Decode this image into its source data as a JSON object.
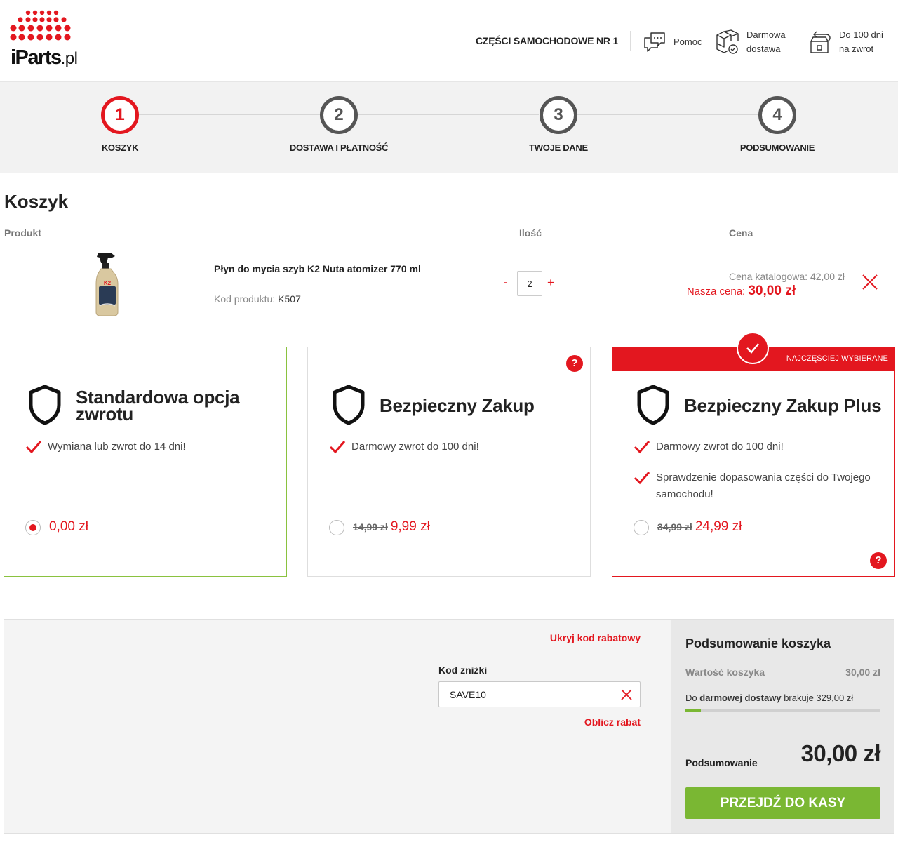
{
  "header": {
    "logo_text": "iParts",
    "logo_tld": ".pl",
    "tagline": "CZĘŚCI SAMOCHODOWE NR 1",
    "help": {
      "icon": "chat-bubbles-icon",
      "label": "Pomoc"
    },
    "delivery": {
      "icon": "boxes-icon",
      "line1": "Darmowa",
      "line2": "dostawa"
    },
    "returns": {
      "icon": "return-box-icon",
      "line1": "Do 100 dni",
      "line2": "na zwrot"
    }
  },
  "steps": [
    {
      "number": "1",
      "label": "KOSZYK",
      "active": true
    },
    {
      "number": "2",
      "label": "DOSTAWA I PŁATNOŚĆ",
      "active": false
    },
    {
      "number": "3",
      "label": "TWOJE DANE",
      "active": false
    },
    {
      "number": "4",
      "label": "PODSUMOWANIE",
      "active": false
    }
  ],
  "cart": {
    "title": "Koszyk",
    "columns": {
      "product": "Produkt",
      "qty": "Ilość",
      "price": "Cena"
    },
    "item": {
      "name": "Płyn do mycia szyb K2 Nuta atomizer 770 ml",
      "code_label": "Kod produktu:",
      "code": "K507",
      "qty": "2",
      "qty_minus": "-",
      "qty_plus": "+",
      "catalog_price": "Cena katalogowa: 42,00 zł",
      "our_price_label": "Nasza cena:",
      "our_price": "30,00 zł"
    }
  },
  "options": [
    {
      "title": "Standardowa opcja zwrotu",
      "features": [
        "Wymiana lub zwrot do 14 dni!"
      ],
      "old_price": "",
      "price": "0,00 zł",
      "selected": true
    },
    {
      "title": "Bezpieczny Zakup",
      "features": [
        "Darmowy zwrot do 100 dni!"
      ],
      "old_price": "14,99 zł",
      "price": "9,99 zł",
      "selected": false
    },
    {
      "title": "Bezpieczny Zakup Plus",
      "badge": "NAJCZĘŚCIEJ WYBIERANE",
      "features": [
        "Darmowy zwrot do 100 dni!",
        "Sprawdzenie dopasowania części do Twojego samochodu!"
      ],
      "old_price": "34,99 zł",
      "price": "24,99 zł",
      "selected": false
    }
  ],
  "help_mark": "?",
  "discount": {
    "hide_link": "Ukryj kod rabatowy",
    "label": "Kod zniżki",
    "value": "SAVE10",
    "calculate": "Oblicz rabat"
  },
  "summary": {
    "title": "Podsumowanie koszyka",
    "cart_value_label": "Wartość koszyka",
    "cart_value": "30,00 zł",
    "free_ship_prefix": "Do",
    "free_ship_bold": "darmowej dostawy",
    "free_ship_suffix": "brakuje 329,00 zł",
    "free_ship_progress": 0.08,
    "total_label": "Podsumowanie",
    "total": "30,00 zł",
    "checkout": "PRZEJDŹ DO KASY"
  },
  "colors": {
    "accent": "#e3171f",
    "success": "#7ab733",
    "text": "#222222"
  }
}
